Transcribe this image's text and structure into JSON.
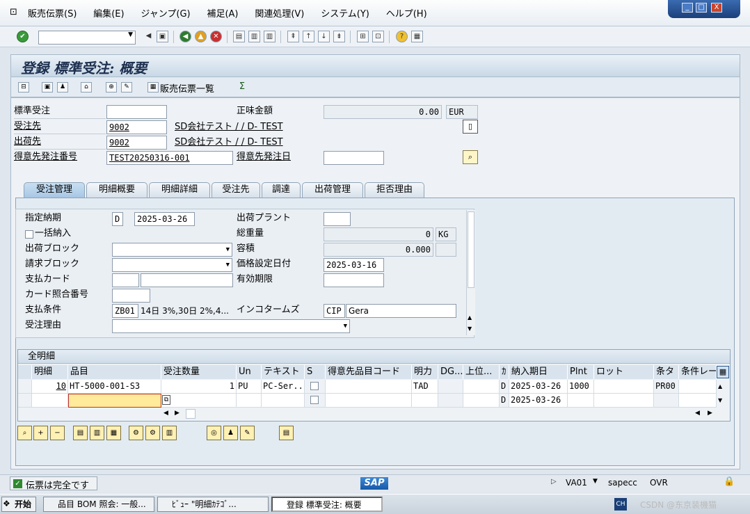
{
  "menu": [
    "販売伝票(S)",
    "編集(E)",
    "ジャンプ(G)",
    "補足(A)",
    "関連処理(V)",
    "システム(Y)",
    "ヘルプ(H)"
  ],
  "window_controls": [
    "_",
    "□",
    "X"
  ],
  "page_title": "登録 標準受注: 概要",
  "app_toolbar": {
    "sales_doc_list": "販売伝票一覧"
  },
  "header": {
    "std_order_label": "標準受注",
    "std_order_value": "",
    "net_value_label": "正味金額",
    "net_value": "0.00",
    "currency": "EUR",
    "sold_to_label": "受注先",
    "sold_to_value": "9002",
    "sold_to_name": "SD会社テスト / / D- TEST",
    "ship_to_label": "出荷先",
    "ship_to_value": "9002",
    "ship_to_name": "SD会社テスト / / D- TEST",
    "po_number_label": "得意先発注番号",
    "po_number_value": "TEST20250316-001",
    "po_date_label": "得意先発注日",
    "po_date_value": ""
  },
  "tabs": [
    "受注管理",
    "明細概要",
    "明細詳細",
    "受注先",
    "調達",
    "出荷管理",
    "拒否理由"
  ],
  "active_tab": "受注管理",
  "sales": {
    "req_delivery_date_label": "指定納期",
    "req_delivery_date_type": "D",
    "req_delivery_date": "2025-03-26",
    "delivering_plant_label": "出荷プラント",
    "delivering_plant": "",
    "complete_delivery_label": "一括納入",
    "total_weight_label": "総重量",
    "total_weight": "0",
    "weight_unit": "KG",
    "delivery_block_label": "出荷ブロック",
    "volume_label": "容積",
    "volume": "0.000",
    "billing_block_label": "請求ブロック",
    "pricing_date_label": "価格設定日付",
    "pricing_date": "2025-03-16",
    "payment_card_label": "支払カード",
    "valid_to_label": "有効期限",
    "card_verif_label": "カード照合番号",
    "payment_terms_label": "支払条件",
    "payment_terms_code": "ZB01",
    "payment_terms_text": "14日 3%,30日 2%,4...",
    "incoterms_label": "インコタームズ",
    "incoterms_code": "CIP",
    "incoterms_place": "Gera",
    "order_reason_label": "受注理由"
  },
  "items": {
    "title": "全明細",
    "columns": [
      "明細",
      "品目",
      "受注数量",
      "Un",
      "テキスト",
      "S",
      "得意先品目コード",
      "明力",
      "DG...",
      "上位...",
      "ｶ",
      "納入期日",
      "Plnt",
      "ロット",
      "条タ",
      "条件レー"
    ],
    "rows": [
      {
        "item": "10",
        "material": "HT-5000-001-S3",
        "qty": "1",
        "unit": "PU",
        "text": "PC-Ser...",
        "cat": "TAD",
        "d": "D",
        "date": "2025-03-26",
        "plant": "1000",
        "cond": "PR00"
      },
      {
        "item": "",
        "material": "",
        "qty": "",
        "unit": "",
        "text": "",
        "cat": "",
        "d": "D",
        "date": "2025-03-26",
        "plant": "",
        "cond": ""
      }
    ]
  },
  "status": {
    "message": "伝票は完全です",
    "tcode": "VA01",
    "server": "sapecc",
    "mode": "OVR",
    "sap_logo": "SAP"
  },
  "taskbar": {
    "start": "开始",
    "tasks": [
      "品目 BOM 照会: 一般...",
      "ﾋﾞｭｰ \"明細ｶﾃｺﾞ...",
      "登録 標準受注: 概要"
    ],
    "tray_lang": "CH",
    "watermark": "CSDN @东京装機猫"
  }
}
